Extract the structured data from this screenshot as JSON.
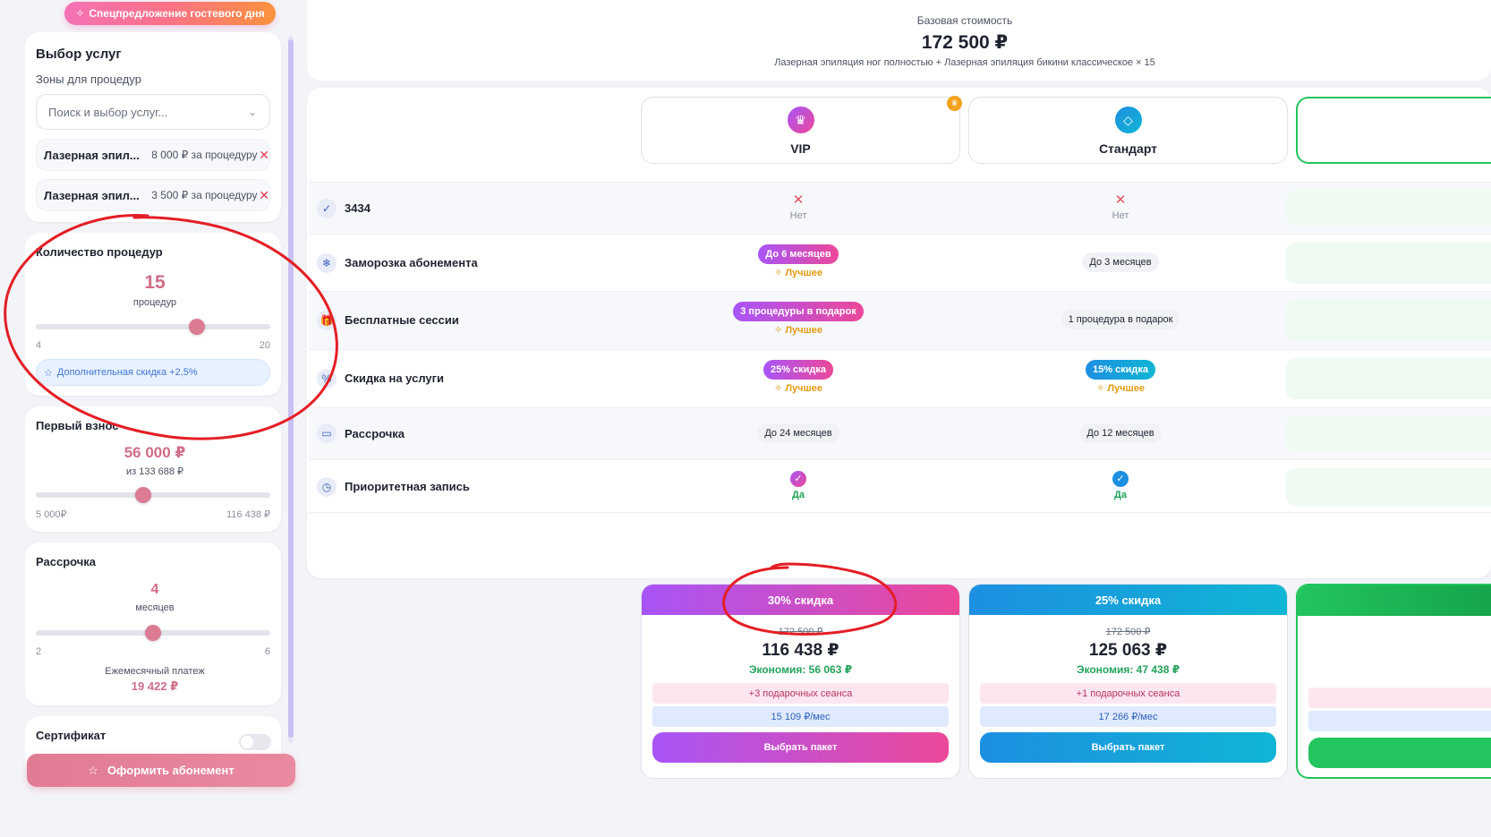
{
  "special_offer": {
    "label": "Спецпредложение гостевого дня"
  },
  "services": {
    "title": "Выбор услуг",
    "zones_label": "Зоны для процедур",
    "search_placeholder": "Поиск и выбор услуг...",
    "selected": [
      {
        "name": "Лазерная эпил...",
        "price": "8 000 ₽ за процедуру"
      },
      {
        "name": "Лазерная эпил...",
        "price": "3 500 ₽ за процедуру"
      }
    ]
  },
  "procedures": {
    "title": "Количество процедур",
    "value": "15",
    "unit": "процедур",
    "min": "4",
    "max": "20",
    "slider_value": 15,
    "slider_min": 4,
    "slider_max": 20,
    "bonus": "Дополнительная скидка +2,5%"
  },
  "first_payment": {
    "title": "Первый взнос",
    "value": "56 000 ₽",
    "of_total": "из 133 688 ₽",
    "min": "5 000₽",
    "max": "116 438 ₽",
    "slider_value": 56000,
    "slider_min": 5000,
    "slider_max": 116438
  },
  "installment": {
    "title": "Рассрочка",
    "value": "4",
    "unit": "месяцев",
    "min": "2",
    "max": "6",
    "slider_value": 4,
    "slider_min": 2,
    "slider_max": 6,
    "monthly_label": "Ежемесячный платеж",
    "monthly_value": "19 422 ₽"
  },
  "certificate": {
    "title": "Сертификат",
    "enabled": false
  },
  "checkout_button": "Оформить абонемент",
  "base": {
    "label": "Базовая стоимость",
    "value": "172 500 ₽",
    "description": "Лазерная эпиляция ног полностью + Лазерная эпиляция бикини классическое × 15"
  },
  "tiers": [
    {
      "name": "VIP",
      "icon": "crown-icon",
      "color": "#c04fd8"
    },
    {
      "name": "Стандарт",
      "icon": "diamond-icon",
      "color": "#1d8fe1"
    }
  ],
  "features": [
    {
      "label": "3434",
      "icon": "check-icon",
      "vip": {
        "type": "no",
        "text": "Нет"
      },
      "std": {
        "type": "no",
        "text": "Нет"
      }
    },
    {
      "label": "Заморозка абонемента",
      "icon": "snowflake-icon",
      "vip": {
        "type": "pill",
        "text": "До 6 месяцев",
        "best": "Лучшее"
      },
      "std": {
        "type": "plain",
        "text": "До 3 месяцев"
      }
    },
    {
      "label": "Бесплатные сессии",
      "icon": "gift-icon",
      "vip": {
        "type": "pill",
        "text": "3 процедуры в подарок",
        "best": "Лучшее"
      },
      "std": {
        "type": "plain",
        "text": "1 процедура в подарок"
      }
    },
    {
      "label": "Скидка на услуги",
      "icon": "percent-icon",
      "vip": {
        "type": "pill",
        "text": "25% скидка",
        "best": "Лучшее"
      },
      "std": {
        "type": "pill",
        "text": "15% скидка",
        "best": "Лучшее"
      }
    },
    {
      "label": "Рассрочка",
      "icon": "card-icon",
      "vip": {
        "type": "plain",
        "text": "До 24 месяцев"
      },
      "std": {
        "type": "plain",
        "text": "До 12 месяцев"
      }
    },
    {
      "label": "Приоритетная запись",
      "icon": "clock-icon",
      "vip": {
        "type": "yes",
        "text": "Да"
      },
      "std": {
        "type": "yes",
        "text": "Да"
      }
    }
  ],
  "packages": [
    {
      "discount": "30% скидка",
      "old_price": "172 500 ₽",
      "price": "116 438 ₽",
      "savings": "Экономия: 56 063 ₽",
      "gift": "+3 подарочных сеанса",
      "monthly": "15 109 ₽/мес",
      "button": "Выбрать пакет"
    },
    {
      "discount": "25% скидка",
      "old_price": "172 500 ₽",
      "price": "125 063 ₽",
      "savings": "Экономия: 47 438 ₽",
      "gift": "+1 подарочных сеанса",
      "monthly": "17 266 ₽/мес",
      "button": "Выбрать пакет"
    }
  ]
}
